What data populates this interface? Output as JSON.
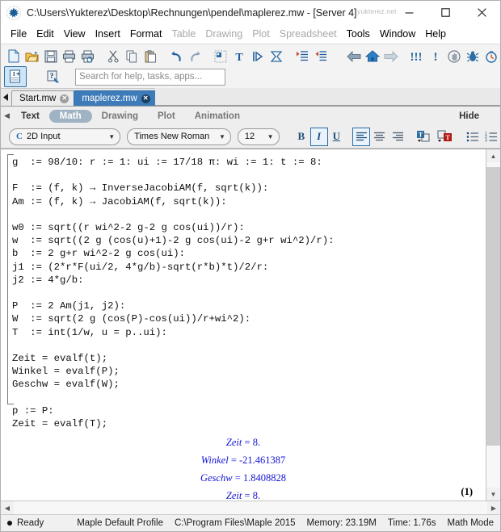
{
  "window": {
    "title": "C:\\Users\\Yukterez\\Desktop\\Rechnungen\\pendel\\maplerez.mw - [Server 4]",
    "watermark": "yukterez.net",
    "minimize_label": "Minimize",
    "maximize_label": "Maximize",
    "close_label": "Close"
  },
  "menu": {
    "items": [
      {
        "label": "File",
        "enabled": true
      },
      {
        "label": "Edit",
        "enabled": true
      },
      {
        "label": "View",
        "enabled": true
      },
      {
        "label": "Insert",
        "enabled": true
      },
      {
        "label": "Format",
        "enabled": true
      },
      {
        "label": "Table",
        "enabled": false
      },
      {
        "label": "Drawing",
        "enabled": false
      },
      {
        "label": "Plot",
        "enabled": false
      },
      {
        "label": "Spreadsheet",
        "enabled": false
      },
      {
        "label": "Tools",
        "enabled": true
      },
      {
        "label": "Window",
        "enabled": true
      },
      {
        "label": "Help",
        "enabled": true
      }
    ]
  },
  "toolbar": {
    "buttons": [
      {
        "name": "new-document-icon",
        "title": "New"
      },
      {
        "name": "open-folder-icon",
        "title": "Open"
      },
      {
        "name": "save-icon",
        "title": "Save"
      },
      {
        "name": "print-icon",
        "title": "Print"
      },
      {
        "name": "print-preview-icon",
        "title": "Print Preview"
      },
      {
        "name": "cut-scissors-icon",
        "title": "Cut"
      },
      {
        "name": "copy-icon",
        "title": "Copy"
      },
      {
        "name": "paste-icon",
        "title": "Paste"
      },
      {
        "name": "undo-arrow-icon",
        "title": "Undo"
      },
      {
        "name": "redo-arrow-icon",
        "title": "Redo"
      },
      {
        "name": "math-input-icon",
        "title": "Math Input"
      },
      {
        "name": "text-input-icon",
        "title": "Text Input"
      },
      {
        "name": "execute-group-icon",
        "title": "Execute"
      },
      {
        "name": "execute-worksheet-icon",
        "title": "Execute Worksheet"
      },
      {
        "name": "indent-right-icon",
        "title": "Indent"
      },
      {
        "name": "indent-left-icon",
        "title": "Outdent"
      },
      {
        "name": "back-arrow-icon",
        "title": "Back"
      },
      {
        "name": "home-icon",
        "title": "Home"
      },
      {
        "name": "forward-arrow-icon",
        "title": "Forward"
      },
      {
        "name": "restart-icon",
        "title": "Restart Kernel"
      },
      {
        "name": "interrupt-icon",
        "title": "Interrupt"
      },
      {
        "name": "pan-hand-icon",
        "title": "Pan"
      },
      {
        "name": "debug-bug-icon",
        "title": "Debug"
      },
      {
        "name": "clock-icon",
        "title": "Timer"
      }
    ],
    "row2": [
      {
        "name": "text-insert-icon",
        "title": "Insert Text"
      },
      {
        "name": "help-icon",
        "title": "Help"
      }
    ]
  },
  "search": {
    "placeholder": "Search for help, tasks, apps...",
    "value": ""
  },
  "document_tabs": [
    {
      "label": "Start.mw",
      "active": false
    },
    {
      "label": "maplerez.mw",
      "active": true
    }
  ],
  "context_bar": {
    "tabs": [
      {
        "label": "Text",
        "state": "enabled"
      },
      {
        "label": "Math",
        "state": "active"
      },
      {
        "label": "Drawing",
        "state": "disabled"
      },
      {
        "label": "Plot",
        "state": "disabled"
      },
      {
        "label": "Animation",
        "state": "disabled"
      }
    ],
    "hide_label": "Hide",
    "input_mode": "2D Input",
    "font_family": "Times New Roman",
    "font_size": "12",
    "bold_label": "B",
    "italic_label": "I",
    "underline_label": "U",
    "align_left": "align-left",
    "align_center": "align-center",
    "align_right": "align-right"
  },
  "document": {
    "code_lines": [
      "g  := 98/10: r := 1: ui := 17/18 π: wi := 1: t := 8:",
      "",
      "F  := (f, k) → InverseJacobiAM(f, sqrt(k)):",
      "Am := (f, k) → JacobiAM(f, sqrt(k)):",
      "",
      "w0 := sqrt((r wi^2-2 g-2 g cos(ui))/r):",
      "w  := sqrt((2 g (cos(u)+1)-2 g cos(ui)-2 g+r wi^2)/r):",
      "b  := 2 g+r wi^2-2 g cos(ui):",
      "j1 := (2*r*F(ui/2, 4*g/b)-sqrt(r*b)*t)/2/r:",
      "j2 := 4*g/b:",
      "",
      "P  := 2 Am(j1, j2):",
      "W  := sqrt(2 g (cos(P)-cos(ui))/r+wi^2):",
      "T  := int(1/w, u = p..ui):",
      "",
      "Zeit = evalf(t);",
      "Winkel = evalf(P);",
      "Geschw = evalf(W);",
      "",
      "p := P:",
      "Zeit = evalf(T);"
    ],
    "results": [
      {
        "name": "Zeit",
        "value": "8."
      },
      {
        "name": "Winkel",
        "value": "-21.461387"
      },
      {
        "name": "Geschw",
        "value": "1.8408828"
      },
      {
        "name": "Zeit",
        "value": "8."
      }
    ],
    "equation_label": "(1)",
    "result_color": "#1414d6"
  },
  "status_bar": {
    "state": "Ready",
    "profile": "Maple Default Profile",
    "path": "C:\\Program Files\\Maple 2015",
    "memory": "Memory: 23.19M",
    "time": "Time: 1.76s",
    "mode": "Math Mode"
  }
}
